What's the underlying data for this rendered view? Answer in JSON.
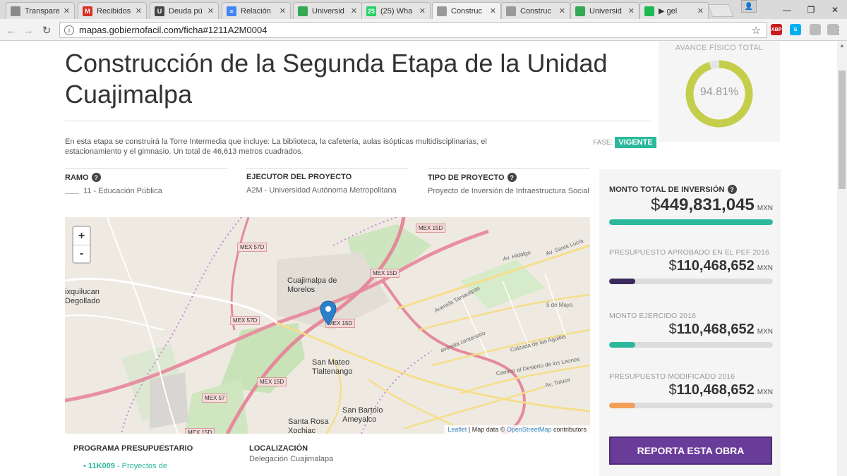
{
  "browser": {
    "tabs": [
      {
        "label": "Transpare",
        "icon": "globe-icon",
        "color": "#8a8a8a",
        "glyph": ""
      },
      {
        "label": "Recibidos",
        "icon": "gmail-icon",
        "color": "#d93025",
        "glyph": "M"
      },
      {
        "label": "Deuda pú",
        "icon": "site-icon",
        "color": "#444444",
        "glyph": "U"
      },
      {
        "label": "Relación",
        "icon": "docs-icon",
        "color": "#4285f4",
        "glyph": "≡"
      },
      {
        "label": "Universid",
        "icon": "maps-icon",
        "color": "#34a853",
        "glyph": ""
      },
      {
        "label": "(25) Wha",
        "icon": "whatsapp-icon",
        "color": "#25d366",
        "glyph": "25"
      },
      {
        "label": "Construc",
        "icon": "page-icon",
        "color": "#999999",
        "glyph": ""
      },
      {
        "label": "Construc",
        "icon": "page-icon",
        "color": "#999999",
        "glyph": ""
      },
      {
        "label": "Universid",
        "icon": "maps-icon",
        "color": "#34a853",
        "glyph": ""
      },
      {
        "label": "▶ gel",
        "icon": "spotify-icon",
        "color": "#1db954",
        "glyph": ""
      }
    ],
    "active_tab": 6,
    "url": "mapas.gobiernofacil.com/ficha#1211A2M0004",
    "extensions": [
      {
        "name": "abp-icon",
        "label": "ABP",
        "color": "#c81e1e"
      },
      {
        "name": "skype-icon",
        "label": "S",
        "color": "#00aff0"
      },
      {
        "name": "extension-icon",
        "label": "",
        "color": "#bbbbbb"
      },
      {
        "name": "extension-icon-2",
        "label": "",
        "color": "#bbbbbb"
      }
    ]
  },
  "page": {
    "title": "Construcción de la Segunda Etapa de la Unidad Cuajimalpa",
    "description": "En esta etapa se construirá la Torre Intermedia que incluye: La biblioteca, la cafetería, aulas isópticas multidisciplinarias, el estacionamiento y el gimnasio. Un total de 46,613 metros cuadrados.",
    "fase_label": "FASE:",
    "fase_value": "VIGENTE",
    "avance_label": "AVANCE FÍSICO TOTAL",
    "avance_value": "94.81%",
    "avance_fraction": 0.9481,
    "ramo": {
      "label": "RAMO",
      "value": "11 - Educación Pública"
    },
    "ejecutor": {
      "label": "EJECUTOR DEL PROYECTO",
      "value": "A2M - Universidad Autónoma Metropolitana"
    },
    "tipo": {
      "label": "TIPO DE PROYECTO",
      "value": "Proyecto de Inversión de Infraestructura Social"
    },
    "programa": {
      "label": "PROGRAMA PRESUPUESTARIO",
      "code": "11K009",
      "value": "- Proyectos de"
    },
    "localizacion": {
      "label": "LOCALIZACIÓN",
      "value": "Delegación Cuajimalapa"
    }
  },
  "map": {
    "zoom_in": "+",
    "zoom_out": "-",
    "labels": {
      "cuajimalpa": "Cuajimalpa de Morelos",
      "huixquilucan": "ixquilucan Degollado",
      "san_mateo": "San Mateo Tlaltenango",
      "santa_rosa": "Santa Rosa Xochiac",
      "san_bartolo": "San Bartolo Ameyalco",
      "mex15d_a": "MEX 15D",
      "mex15d_b": "MEX 15D",
      "mex15d_c": "MEX 15D",
      "mex15d_d": "MEX 15D",
      "mex15d_e": "MEX 15D",
      "mex57d_a": "MEX 57D",
      "mex57d_b": "MEX 57D",
      "mex57": "MEX 57",
      "av_tamaulipas": "Avenida Tamaulipas",
      "av_centenario": "avenida centenario",
      "calzada": "Calzada de las Aguilas",
      "desierto": "Camino al Desierto de los Leones",
      "toluca": "Av. Toluca",
      "hidalgo": "Av. Hidalgo",
      "santa_lucia": "Av. Santa Lucía",
      "mayo": "5 de Mayo"
    },
    "attribution_leaflet": "Leaflet",
    "attribution_text": "| Map data ©",
    "attribution_osm": "OpenStreetMap",
    "attribution_end": "contributors"
  },
  "investment": {
    "total": {
      "label": "MONTO TOTAL DE INVERSIÓN",
      "currency": "$",
      "amount": "449,831,045",
      "unit": "MXN",
      "fraction": 1.0,
      "color": "#2bb89c"
    },
    "items": [
      {
        "label": "PRESUPUESTO APROBADO EN EL PEF 2016",
        "currency": "$",
        "amount": "110,468,652",
        "unit": "MXN",
        "fraction": 0.16,
        "color": "#3d2a5c"
      },
      {
        "label": "MONTO EJERCIDO 2016",
        "currency": "$",
        "amount": "110,468,652",
        "unit": "MXN",
        "fraction": 0.16,
        "color": "#2bb89c"
      },
      {
        "label": "PRESUPUESTO MODIFICADO 2016",
        "currency": "$",
        "amount": "110,468,652",
        "unit": "MXN",
        "fraction": 0.16,
        "color": "#f5a05a"
      }
    ],
    "report_button": "REPORTA ESTA OBRA"
  },
  "colors": {
    "accent": "#2bb89c",
    "purple": "#6a3c9a",
    "donut": "#c5ce4a"
  }
}
